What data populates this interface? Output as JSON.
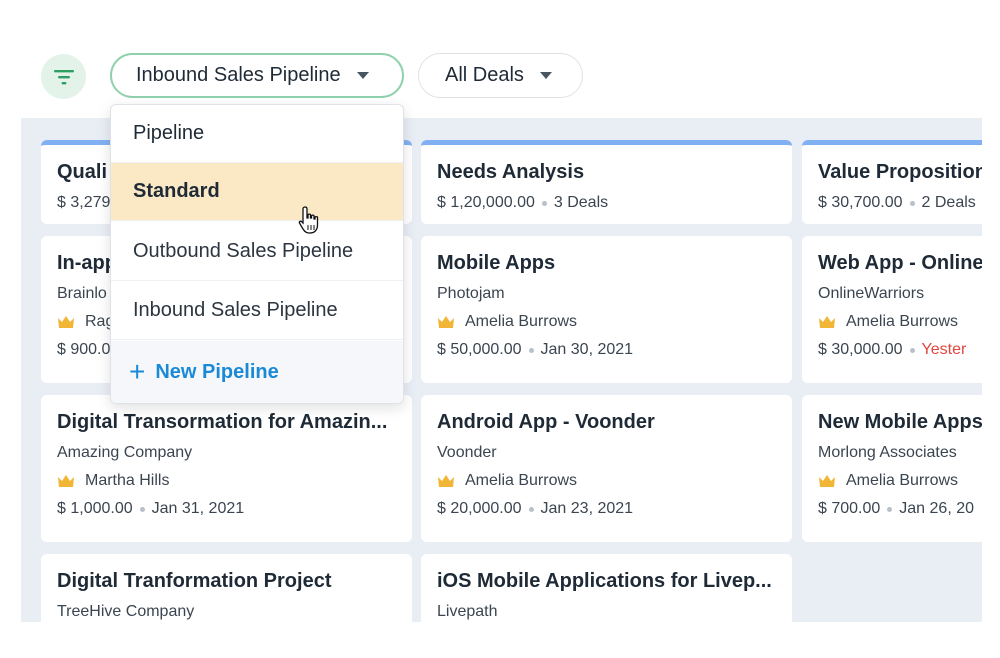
{
  "toolbar": {
    "filter_icon": "filter-icon",
    "pipeline_selector": "Inbound Sales Pipeline",
    "view_selector": "All Deals"
  },
  "dropdown": {
    "header": "Pipeline",
    "items": [
      "Standard",
      "Outbound Sales Pipeline",
      "Inbound Sales Pipeline"
    ],
    "selected": "Standard",
    "new_pipeline": "New Pipeline"
  },
  "columns": [
    {
      "stage": "Quali",
      "amount": "$ 3,279",
      "deal_count": "",
      "cards": [
        {
          "title": "In-app",
          "company": "Brainlo",
          "owner": "Rag",
          "amount": "$ 900.0",
          "date": ""
        },
        {
          "title": "Digital Transormation for Amazin...",
          "company": "Amazing Company",
          "owner": "Martha Hills",
          "amount": "$ 1,000.00",
          "date": "Jan 31, 2021"
        },
        {
          "title": "Digital Tranformation Project",
          "company": "TreeHive Company",
          "owner": "",
          "amount": "",
          "date": ""
        }
      ]
    },
    {
      "stage": "Needs Analysis",
      "amount": "$ 1,20,000.00",
      "deal_count": "3 Deals",
      "cards": [
        {
          "title": "Mobile Apps",
          "company": "Photojam",
          "owner": "Amelia Burrows",
          "amount": "$ 50,000.00",
          "date": "Jan 30, 2021"
        },
        {
          "title": "Android App - Voonder",
          "company": "Voonder",
          "owner": "Amelia Burrows",
          "amount": "$ 20,000.00",
          "date": "Jan 23, 2021"
        },
        {
          "title": "iOS Mobile Applications for Livep...",
          "company": "Livepath",
          "owner": "",
          "amount": "",
          "date": ""
        }
      ]
    },
    {
      "stage": "Value Proposition",
      "amount": "$ 30,700.00",
      "deal_count": "2 Deals",
      "cards": [
        {
          "title": "Web App - Online",
          "company": "OnlineWarriors",
          "owner": "Amelia Burrows",
          "amount": "$ 30,000.00",
          "date": "Yester"
        },
        {
          "title": "New Mobile Apps",
          "company": "Morlong Associates",
          "owner": "Amelia Burrows",
          "amount": "$ 700.00",
          "date": "Jan 26, 20"
        }
      ]
    }
  ],
  "colors": {
    "accent_green": "#8fd1ad",
    "column_top": "#82b1f3",
    "link_blue": "#1b8ad6",
    "selected_bg": "#fbe8c4",
    "overdue_red": "#e2463f"
  }
}
